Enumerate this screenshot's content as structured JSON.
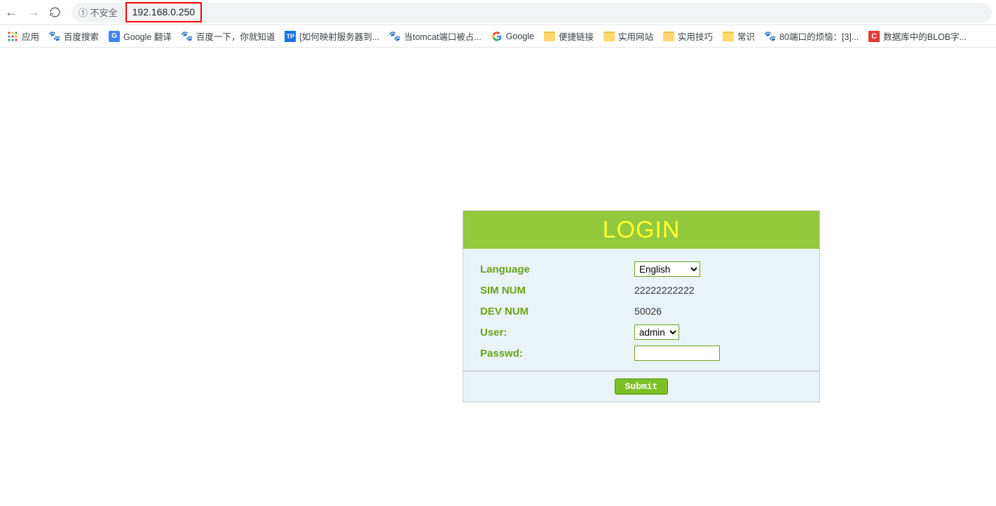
{
  "browser": {
    "insecure_label": "① 不安全",
    "url": "192.168.0.250"
  },
  "bookmarks": {
    "apps": "应用",
    "items": [
      "百度搜索",
      "Google 翻译",
      "百度一下，你就知道",
      "[如何映射服务器到...",
      "当tomcat端口被占...",
      "Google",
      "便捷链接",
      "实用网站",
      "实用技巧",
      "常识",
      "80端口的烦恼：[3]...",
      "数据库中的BLOB字..."
    ]
  },
  "login": {
    "title": "LOGIN",
    "labels": {
      "language": "Language",
      "sim": "SIM NUM",
      "dev": "DEV NUM",
      "user": "User:",
      "passwd": "Passwd:"
    },
    "language_value": "English",
    "sim_value": "22222222222",
    "dev_value": "50026",
    "user_value": "admin",
    "submit": "Submit"
  }
}
